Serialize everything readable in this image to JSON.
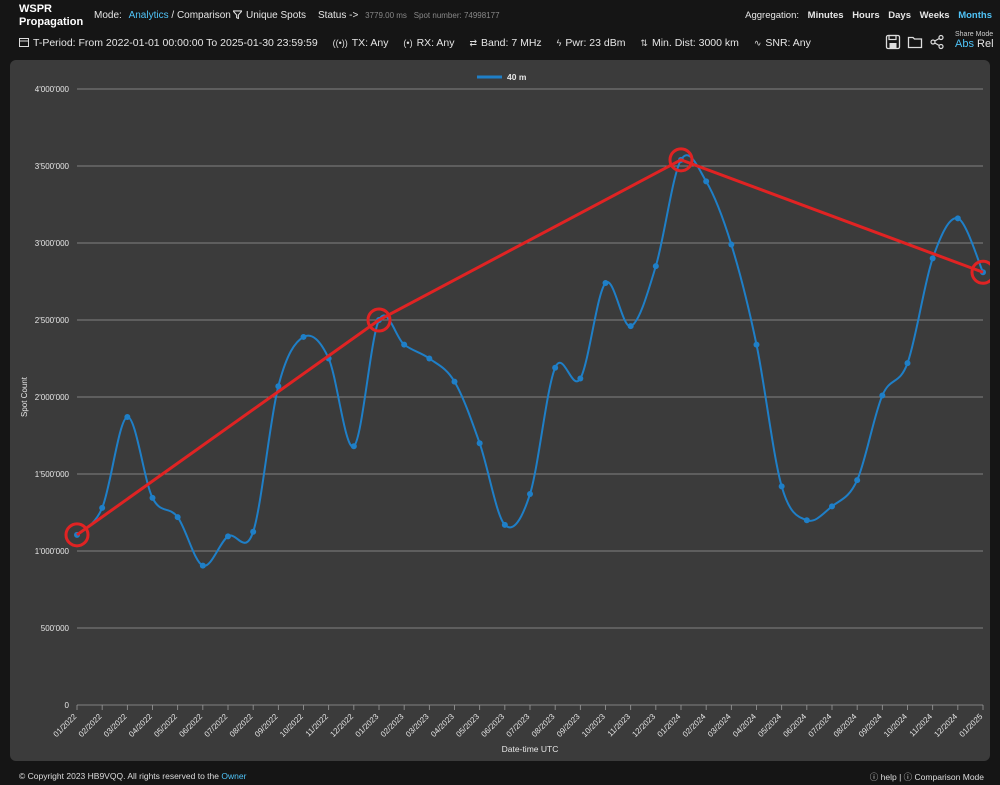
{
  "app": {
    "title_line1": "WSPR",
    "title_line2": "Propagation"
  },
  "header": {
    "mode_label": "Mode:",
    "mode_analytics": "Analytics",
    "mode_sep": " / ",
    "mode_comparison": "Comparison",
    "unique_spots": "Unique Spots",
    "status_label": "Status ->",
    "status_ms": "3779.00 ms",
    "spot_number": "Spot number: 74998177",
    "aggregation_label": "Aggregation:",
    "aggregation": [
      "Minutes",
      "Hours",
      "Days",
      "Weeks",
      "Months"
    ],
    "aggregation_selected": "Months"
  },
  "filters": {
    "period": "T-Period: From 2022-01-01 00:00:00 To 2025-01-30 23:59:59",
    "tx": "TX: Any",
    "rx": "RX: Any",
    "band": "Band: 7 MHz",
    "pwr": "Pwr: 23 dBm",
    "min_dist": "Min. Dist: 3000 km",
    "snr": "SNR: Any"
  },
  "share": {
    "label": "Share Mode",
    "abs": "Abs",
    "rel": "Rel"
  },
  "colors": {
    "series": "#1f7fc7",
    "overlay": "#e02323",
    "grid": "#9a9a9a",
    "panel": "#3b3b3b"
  },
  "chart_data": {
    "type": "line",
    "title": "",
    "xlabel": "Date-time UTC",
    "ylabel": "Spot Count",
    "ylim": [
      0,
      4000000
    ],
    "yticks": [
      "0",
      "500'000",
      "1'000'000",
      "1'500'000",
      "2'000'000",
      "2'500'000",
      "3'000'000",
      "3'500'000",
      "4'000'000"
    ],
    "legend": "top-center",
    "grid": true,
    "categories": [
      "01/2022",
      "02/2022",
      "03/2022",
      "04/2022",
      "05/2022",
      "06/2022",
      "07/2022",
      "08/2022",
      "09/2022",
      "10/2022",
      "11/2022",
      "12/2022",
      "01/2023",
      "02/2023",
      "03/2023",
      "04/2023",
      "05/2023",
      "06/2023",
      "07/2023",
      "08/2023",
      "09/2023",
      "10/2023",
      "11/2023",
      "12/2023",
      "01/2024",
      "02/2024",
      "03/2024",
      "04/2024",
      "05/2024",
      "06/2024",
      "07/2024",
      "08/2024",
      "09/2024",
      "10/2024",
      "11/2024",
      "12/2024",
      "01/2025"
    ],
    "series": [
      {
        "name": "40 m",
        "values": [
          1105000,
          1280000,
          1870000,
          1345000,
          1220000,
          905000,
          1095000,
          1125000,
          2070000,
          2390000,
          2250000,
          1680000,
          2500000,
          2340000,
          2250000,
          2100000,
          1700000,
          1170000,
          1370000,
          2190000,
          2120000,
          2740000,
          2460000,
          2850000,
          3540000,
          3400000,
          2990000,
          2340000,
          1420000,
          1200000,
          1290000,
          1460000,
          2010000,
          2220000,
          2900000,
          3160000,
          2810000
        ]
      }
    ],
    "annotations": {
      "circled_points": [
        0,
        12,
        24,
        36
      ],
      "connector": "red line through circled points"
    }
  }
}
